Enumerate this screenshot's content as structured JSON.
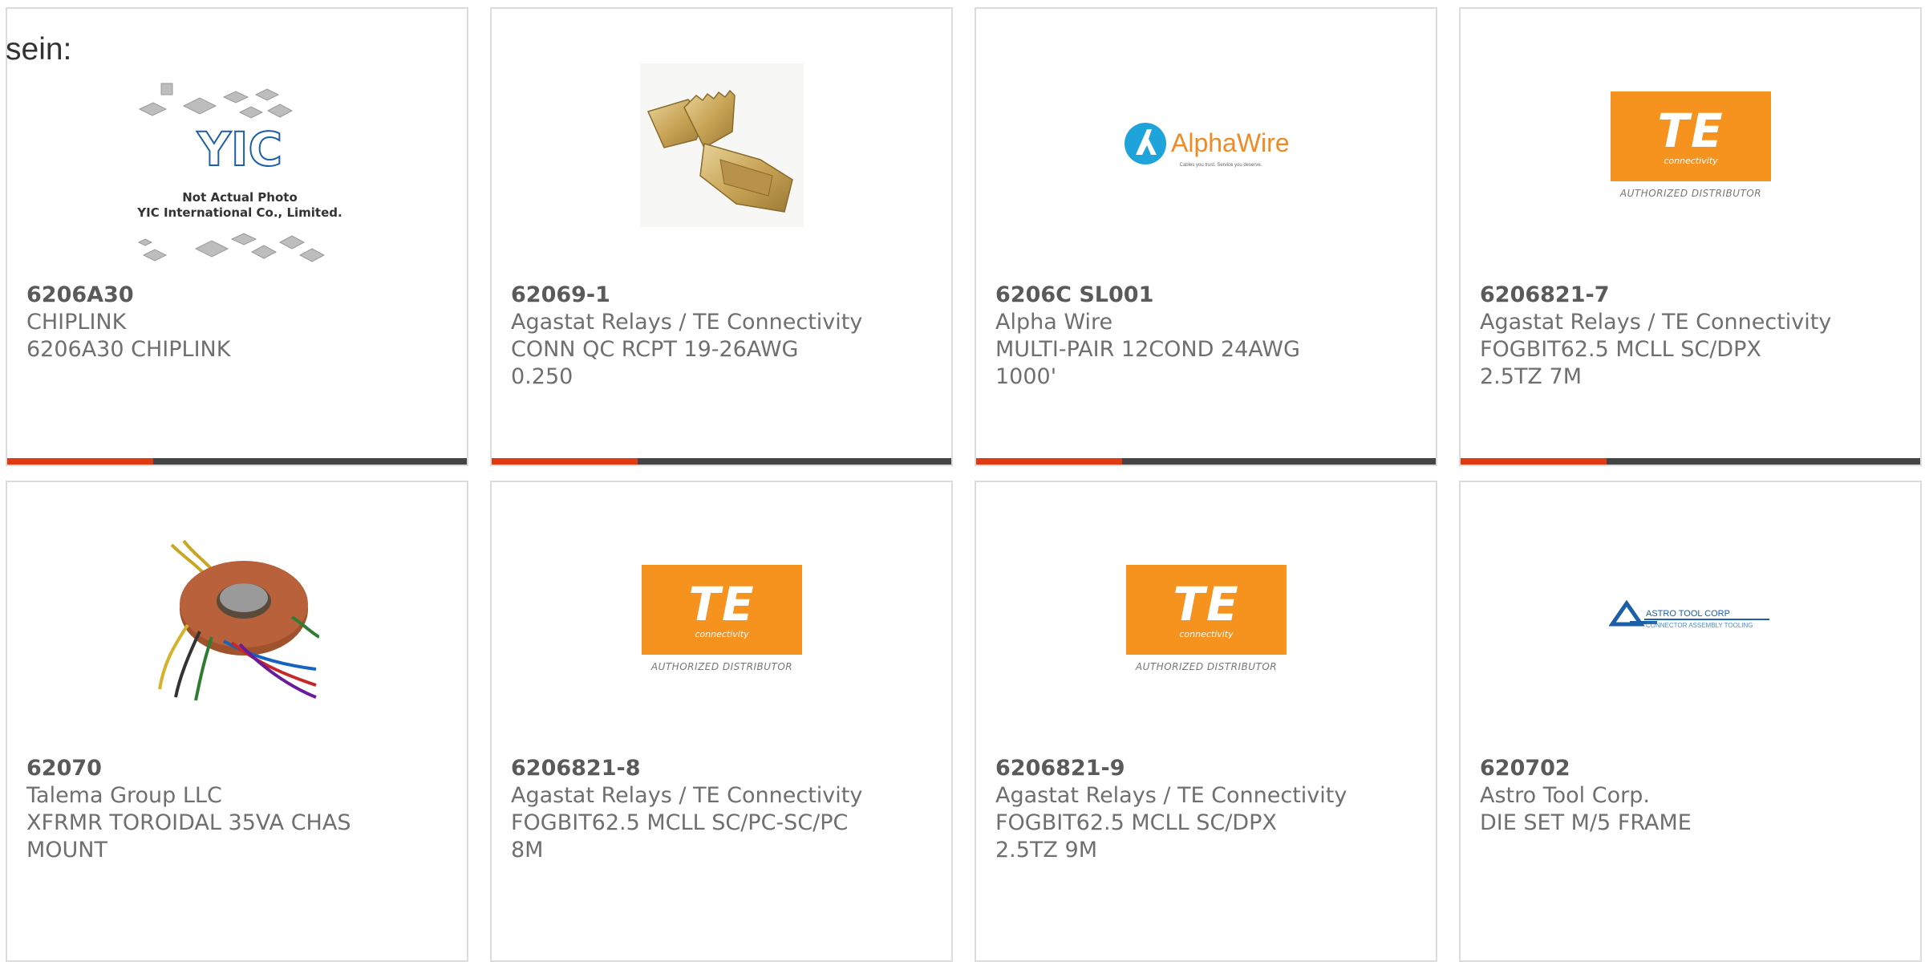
{
  "intro_text": "sein:",
  "colors": {
    "accent": "#e03a12",
    "bar": "#444444",
    "te_orange": "#f6921e",
    "alphawire_blue": "#1fa3db",
    "alphawire_orange": "#f08a24"
  },
  "cards": [
    {
      "part": "6206A30",
      "manufacturer": "CHIPLINK",
      "description": "6206A30 CHIPLINK",
      "image": "not-actual-photo",
      "photo_caption": [
        "Not Actual Photo",
        "YIC International Co., Limited."
      ],
      "logo_text": "YIC"
    },
    {
      "part": "62069-1",
      "manufacturer": "Agastat Relays / TE Connectivity",
      "description": "CONN QC RCPT 19-26AWG 0.250",
      "image": "crimp-terminal"
    },
    {
      "part": "6206C SL001",
      "manufacturer": "Alpha Wire",
      "description": "MULTI-PAIR 12COND 24AWG 1000'",
      "image": "alphawire-logo",
      "logo_text": "AlphaWire",
      "logo_tagline": "Cables you trust. Service you deserve."
    },
    {
      "part": "6206821-7",
      "manufacturer": "Agastat Relays / TE Connectivity",
      "description": "FOGBIT62.5 MCLL SC/DPX 2.5TZ 7M",
      "image": "te-logo",
      "logo_text": "TE",
      "logo_sub": "connectivity",
      "logo_caption": "AUTHORIZED DISTRIBUTOR"
    },
    {
      "part": "62070",
      "manufacturer": "Talema Group LLC",
      "description": "XFRMR TOROIDAL 35VA CHAS MOUNT",
      "image": "toroidal-transformer"
    },
    {
      "part": "6206821-8",
      "manufacturer": "Agastat Relays / TE Connectivity",
      "description": "FOGBIT62.5 MCLL SC/PC-SC/PC 8M",
      "image": "te-logo",
      "logo_text": "TE",
      "logo_sub": "connectivity",
      "logo_caption": "AUTHORIZED DISTRIBUTOR"
    },
    {
      "part": "6206821-9",
      "manufacturer": "Agastat Relays / TE Connectivity",
      "description": "FOGBIT62.5 MCLL SC/DPX 2.5TZ 9M",
      "image": "te-logo",
      "logo_text": "TE",
      "logo_sub": "connectivity",
      "logo_caption": "AUTHORIZED DISTRIBUTOR"
    },
    {
      "part": "620702",
      "manufacturer": "Astro Tool Corp.",
      "description": "DIE SET M/5 FRAME",
      "image": "astro-tool-logo",
      "logo_text": "ASTRO TOOL CORP",
      "logo_sub": "CONNECTOR ASSEMBLY TOOLING"
    }
  ]
}
